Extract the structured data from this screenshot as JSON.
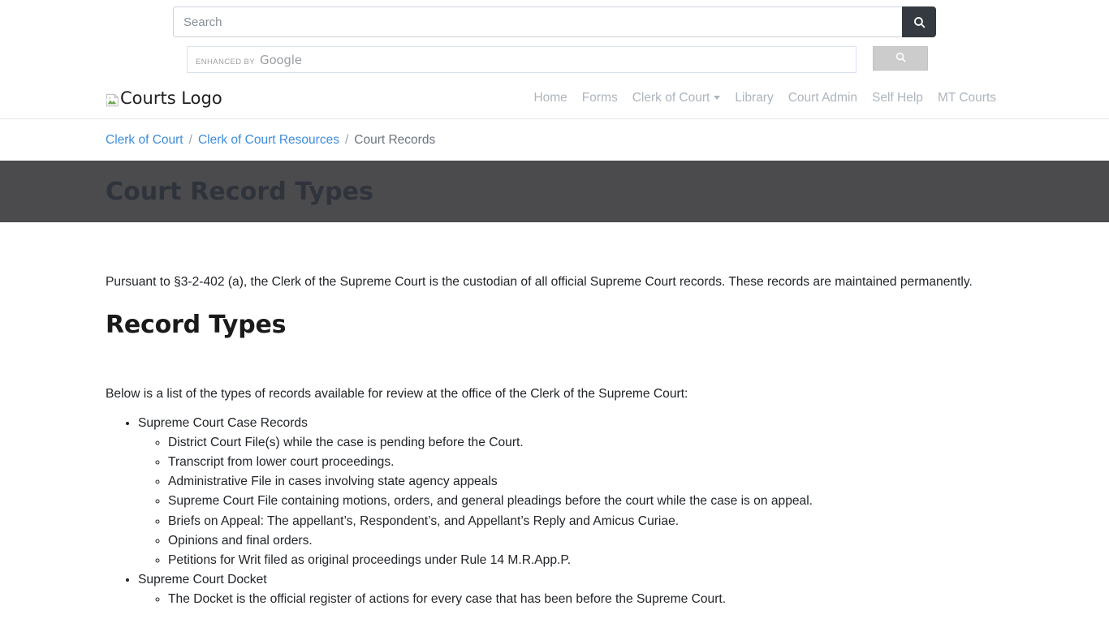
{
  "search": {
    "placeholder": "Search",
    "value": "",
    "button_icon": "search-icon"
  },
  "google_search": {
    "enhanced_label": "ENHANCED BY",
    "brand_label": "Google",
    "value": "",
    "button_icon": "search-icon"
  },
  "header": {
    "logo_alt": "Courts Logo",
    "nav": [
      {
        "label": "Home",
        "has_caret": false
      },
      {
        "label": "Forms",
        "has_caret": false
      },
      {
        "label": "Clerk of Court",
        "has_caret": true
      },
      {
        "label": "Library",
        "has_caret": false
      },
      {
        "label": "Court Admin",
        "has_caret": false
      },
      {
        "label": "Self Help",
        "has_caret": false
      },
      {
        "label": "MT Courts",
        "has_caret": false
      }
    ]
  },
  "breadcrumb": {
    "items": [
      {
        "label": "Clerk of Court",
        "link": true
      },
      {
        "label": "Clerk of Court Resources",
        "link": true
      },
      {
        "label": "Court Records",
        "link": false
      }
    ],
    "separator": "/"
  },
  "banner": {
    "title": "Court Record Types",
    "background": "#4b4b4d",
    "text_color": "#2f333b"
  },
  "main": {
    "intro": "Pursuant to §3-2-402 (a), the Clerk of the Supreme Court is the custodian of all official Supreme Court records. These records are maintained permanently.",
    "section_heading": "Record Types",
    "lead": "Below is a list of the types of records available for review at the office of the Clerk of the Supreme Court:",
    "groups": [
      {
        "label": "Supreme Court Case Records",
        "items": [
          "District Court File(s) while the case is pending before the Court.",
          "Transcript from lower court proceedings.",
          "Administrative File in cases involving state agency appeals",
          "Supreme Court File containing motions, orders, and general pleadings before the court while the case is on appeal.",
          "Briefs on Appeal: The appellant’s, Respondent’s, and Appellant’s Reply and Amicus Curiae.",
          "Opinions and final orders.",
          "Petitions for Writ filed as original proceedings under Rule 14 M.R.App.P."
        ]
      },
      {
        "label": "Supreme Court Docket",
        "items": [
          "The Docket is the official register of actions for every case that has been before the Supreme Court."
        ]
      }
    ]
  },
  "colors": {
    "dark_button": "#343a40",
    "link": "#3f8cd9",
    "nav_link": "#adb5bd",
    "banner": "#4b4b4d"
  }
}
